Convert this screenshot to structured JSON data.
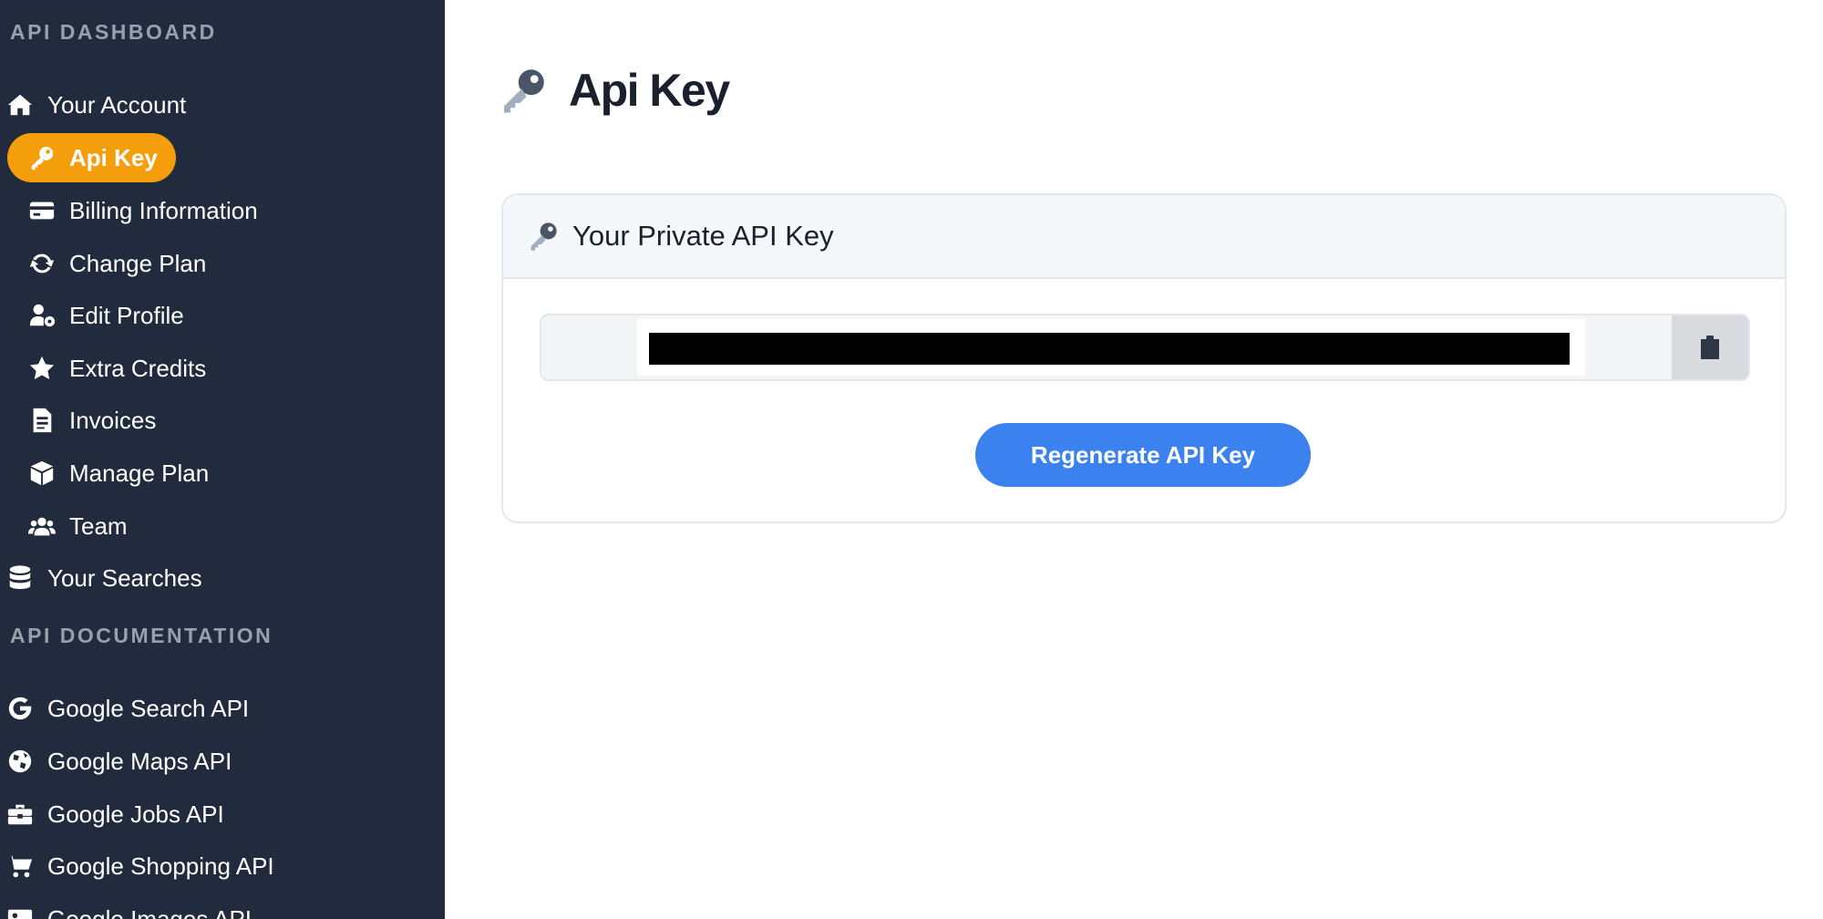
{
  "sidebar": {
    "dashboard_title": "API DASHBOARD",
    "documentation_title": "API DOCUMENTATION",
    "items": [
      {
        "label": "Your Account",
        "icon": "home-icon"
      },
      {
        "label": "Api Key",
        "icon": "key-icon",
        "active": true
      },
      {
        "label": "Billing Information",
        "icon": "credit-card-icon"
      },
      {
        "label": "Change Plan",
        "icon": "sync-icon"
      },
      {
        "label": "Edit Profile",
        "icon": "user-cog-icon"
      },
      {
        "label": "Extra Credits",
        "icon": "star-icon"
      },
      {
        "label": "Invoices",
        "icon": "file-invoice-icon"
      },
      {
        "label": "Manage Plan",
        "icon": "box-icon"
      },
      {
        "label": "Team",
        "icon": "users-icon"
      },
      {
        "label": "Your Searches",
        "icon": "database-icon"
      }
    ],
    "doc_items": [
      {
        "label": "Google Search API",
        "icon": "google-icon"
      },
      {
        "label": "Google Maps API",
        "icon": "globe-icon"
      },
      {
        "label": "Google Jobs API",
        "icon": "briefcase-icon"
      },
      {
        "label": "Google Shopping API",
        "icon": "cart-icon"
      },
      {
        "label": "Google Images API",
        "icon": "image-icon"
      }
    ],
    "accent_color": "#f59e0b",
    "background_color": "#222b3d"
  },
  "main": {
    "page_title": "Api Key",
    "page_title_icon": "key-icon",
    "card": {
      "title": "Your Private API Key",
      "title_icon": "key-icon",
      "copy_icon": "clipboard-icon",
      "regenerate_label": "Regenerate API Key",
      "button_color": "#3b82f0"
    }
  }
}
